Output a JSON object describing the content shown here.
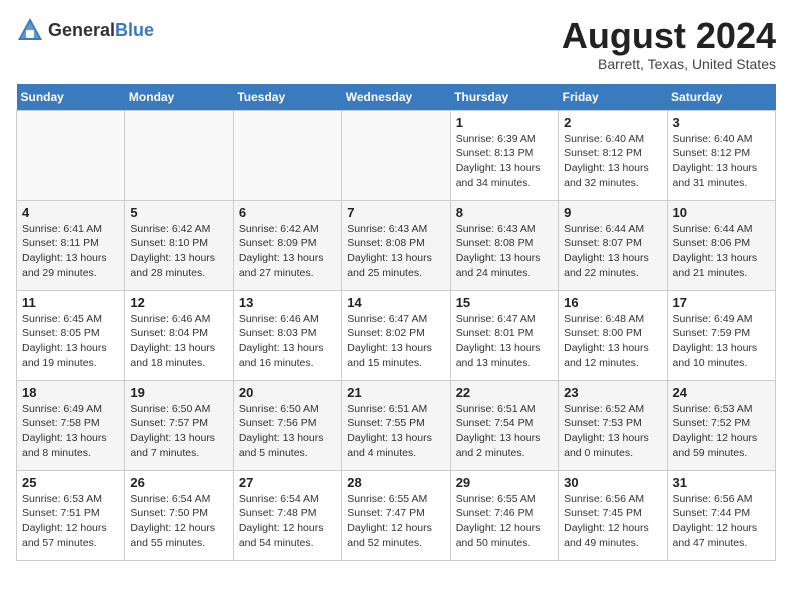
{
  "header": {
    "logo_general": "General",
    "logo_blue": "Blue",
    "month_year": "August 2024",
    "location": "Barrett, Texas, United States"
  },
  "weekdays": [
    "Sunday",
    "Monday",
    "Tuesday",
    "Wednesday",
    "Thursday",
    "Friday",
    "Saturday"
  ],
  "weeks": [
    [
      {
        "day": "",
        "info": ""
      },
      {
        "day": "",
        "info": ""
      },
      {
        "day": "",
        "info": ""
      },
      {
        "day": "",
        "info": ""
      },
      {
        "day": "1",
        "info": "Sunrise: 6:39 AM\nSunset: 8:13 PM\nDaylight: 13 hours\nand 34 minutes."
      },
      {
        "day": "2",
        "info": "Sunrise: 6:40 AM\nSunset: 8:12 PM\nDaylight: 13 hours\nand 32 minutes."
      },
      {
        "day": "3",
        "info": "Sunrise: 6:40 AM\nSunset: 8:12 PM\nDaylight: 13 hours\nand 31 minutes."
      }
    ],
    [
      {
        "day": "4",
        "info": "Sunrise: 6:41 AM\nSunset: 8:11 PM\nDaylight: 13 hours\nand 29 minutes."
      },
      {
        "day": "5",
        "info": "Sunrise: 6:42 AM\nSunset: 8:10 PM\nDaylight: 13 hours\nand 28 minutes."
      },
      {
        "day": "6",
        "info": "Sunrise: 6:42 AM\nSunset: 8:09 PM\nDaylight: 13 hours\nand 27 minutes."
      },
      {
        "day": "7",
        "info": "Sunrise: 6:43 AM\nSunset: 8:08 PM\nDaylight: 13 hours\nand 25 minutes."
      },
      {
        "day": "8",
        "info": "Sunrise: 6:43 AM\nSunset: 8:08 PM\nDaylight: 13 hours\nand 24 minutes."
      },
      {
        "day": "9",
        "info": "Sunrise: 6:44 AM\nSunset: 8:07 PM\nDaylight: 13 hours\nand 22 minutes."
      },
      {
        "day": "10",
        "info": "Sunrise: 6:44 AM\nSunset: 8:06 PM\nDaylight: 13 hours\nand 21 minutes."
      }
    ],
    [
      {
        "day": "11",
        "info": "Sunrise: 6:45 AM\nSunset: 8:05 PM\nDaylight: 13 hours\nand 19 minutes."
      },
      {
        "day": "12",
        "info": "Sunrise: 6:46 AM\nSunset: 8:04 PM\nDaylight: 13 hours\nand 18 minutes."
      },
      {
        "day": "13",
        "info": "Sunrise: 6:46 AM\nSunset: 8:03 PM\nDaylight: 13 hours\nand 16 minutes."
      },
      {
        "day": "14",
        "info": "Sunrise: 6:47 AM\nSunset: 8:02 PM\nDaylight: 13 hours\nand 15 minutes."
      },
      {
        "day": "15",
        "info": "Sunrise: 6:47 AM\nSunset: 8:01 PM\nDaylight: 13 hours\nand 13 minutes."
      },
      {
        "day": "16",
        "info": "Sunrise: 6:48 AM\nSunset: 8:00 PM\nDaylight: 13 hours\nand 12 minutes."
      },
      {
        "day": "17",
        "info": "Sunrise: 6:49 AM\nSunset: 7:59 PM\nDaylight: 13 hours\nand 10 minutes."
      }
    ],
    [
      {
        "day": "18",
        "info": "Sunrise: 6:49 AM\nSunset: 7:58 PM\nDaylight: 13 hours\nand 8 minutes."
      },
      {
        "day": "19",
        "info": "Sunrise: 6:50 AM\nSunset: 7:57 PM\nDaylight: 13 hours\nand 7 minutes."
      },
      {
        "day": "20",
        "info": "Sunrise: 6:50 AM\nSunset: 7:56 PM\nDaylight: 13 hours\nand 5 minutes."
      },
      {
        "day": "21",
        "info": "Sunrise: 6:51 AM\nSunset: 7:55 PM\nDaylight: 13 hours\nand 4 minutes."
      },
      {
        "day": "22",
        "info": "Sunrise: 6:51 AM\nSunset: 7:54 PM\nDaylight: 13 hours\nand 2 minutes."
      },
      {
        "day": "23",
        "info": "Sunrise: 6:52 AM\nSunset: 7:53 PM\nDaylight: 13 hours\nand 0 minutes."
      },
      {
        "day": "24",
        "info": "Sunrise: 6:53 AM\nSunset: 7:52 PM\nDaylight: 12 hours\nand 59 minutes."
      }
    ],
    [
      {
        "day": "25",
        "info": "Sunrise: 6:53 AM\nSunset: 7:51 PM\nDaylight: 12 hours\nand 57 minutes."
      },
      {
        "day": "26",
        "info": "Sunrise: 6:54 AM\nSunset: 7:50 PM\nDaylight: 12 hours\nand 55 minutes."
      },
      {
        "day": "27",
        "info": "Sunrise: 6:54 AM\nSunset: 7:48 PM\nDaylight: 12 hours\nand 54 minutes."
      },
      {
        "day": "28",
        "info": "Sunrise: 6:55 AM\nSunset: 7:47 PM\nDaylight: 12 hours\nand 52 minutes."
      },
      {
        "day": "29",
        "info": "Sunrise: 6:55 AM\nSunset: 7:46 PM\nDaylight: 12 hours\nand 50 minutes."
      },
      {
        "day": "30",
        "info": "Sunrise: 6:56 AM\nSunset: 7:45 PM\nDaylight: 12 hours\nand 49 minutes."
      },
      {
        "day": "31",
        "info": "Sunrise: 6:56 AM\nSunset: 7:44 PM\nDaylight: 12 hours\nand 47 minutes."
      }
    ]
  ]
}
